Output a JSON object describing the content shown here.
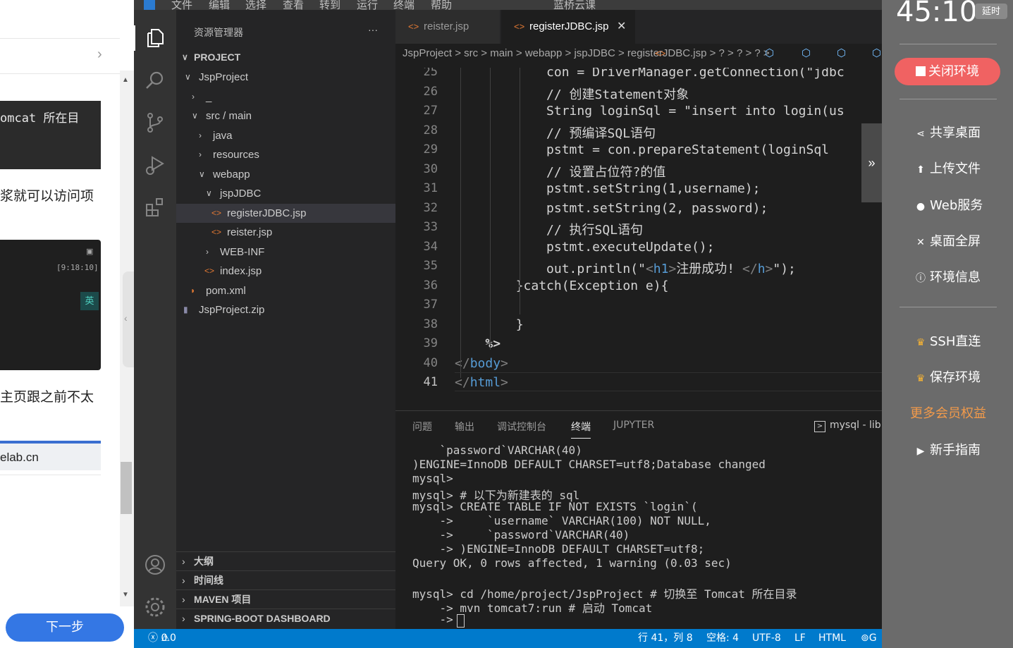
{
  "left_panel": {
    "t1": "omcat 所在目",
    "t2": "浆就可以访问项",
    "t3": "主页跟之前不太",
    "t4": "elab.cn",
    "term_time": "[9:18:10]",
    "term_lang": "英",
    "next_button": "下一步"
  },
  "menu": [
    "文件",
    "编辑",
    "选择",
    "查看",
    "转到",
    "运行",
    "终端",
    "帮助"
  ],
  "window_title": "蓝桥云课",
  "explorer": {
    "title": "资源管理器",
    "more": "···",
    "root": "PROJECT",
    "items": [
      {
        "label": "JspProject",
        "chev": "v",
        "indent": 22
      },
      {
        "label": "_",
        "chev": ">",
        "indent": 32
      },
      {
        "label": "src / main",
        "chev": "v",
        "indent": 32
      },
      {
        "label": "java",
        "chev": ">",
        "indent": 42
      },
      {
        "label": "resources",
        "chev": ">",
        "indent": 42
      },
      {
        "label": "webapp",
        "chev": "v",
        "indent": 42
      },
      {
        "label": "jspJDBC",
        "chev": "v",
        "indent": 52
      },
      {
        "label": "registerJDBC.jsp",
        "icon": "<>",
        "indent": 62
      },
      {
        "label": "reister.jsp",
        "icon": "<>",
        "indent": 62
      },
      {
        "label": "WEB-INF",
        "chev": ">",
        "indent": 52
      },
      {
        "label": "index.jsp",
        "icon": "<>",
        "indent": 52
      },
      {
        "label": "pom.xml",
        "icon": "rss",
        "indent": 32
      },
      {
        "label": "JspProject.zip",
        "icon": "zip",
        "indent": 22
      }
    ],
    "sections": [
      "大纲",
      "时间线",
      "MAVEN 项目",
      "SPRING-BOOT DASHBOARD"
    ]
  },
  "tabs": [
    {
      "label": "reister.jsp",
      "active": false
    },
    {
      "label": "registerJDBC.jsp",
      "active": true
    }
  ],
  "breadcrumb": "JspProject  >  src  >  main  >  webapp  >  jspJDBC  >   registerJDBC.jsp  >     ?  >     ?  >     ?  >",
  "code": {
    "lines": [
      {
        "n": "25",
        "text": "            con = DriverManager.getConnection(\"jdbc"
      },
      {
        "n": "26",
        "text": "            // 创建Statement对象"
      },
      {
        "n": "27",
        "text": "            String loginSql = \"insert into login(us"
      },
      {
        "n": "28",
        "text": "            // 预编译SQL语句"
      },
      {
        "n": "29",
        "text": "            pstmt = con.prepareStatement(loginSql"
      },
      {
        "n": "30",
        "text": "            // 设置占位符?的值"
      },
      {
        "n": "31",
        "text": "            pstmt.setString(1,username);"
      },
      {
        "n": "32",
        "text": "            pstmt.setString(2, password);"
      },
      {
        "n": "33",
        "text": "            // 执行SQL语句"
      },
      {
        "n": "34",
        "text": "            pstmt.executeUpdate();"
      },
      {
        "n": "35",
        "text": "            out.println(\"<h1>注册成功! </h>\");"
      },
      {
        "n": "36",
        "text": "        }catch(Exception e){"
      },
      {
        "n": "37",
        "text": ""
      },
      {
        "n": "38",
        "text": "        }"
      },
      {
        "n": "39",
        "text": "    %>"
      },
      {
        "n": "40",
        "text": "</body>"
      },
      {
        "n": "41",
        "text": "</html>"
      }
    ]
  },
  "panel": {
    "tabs": [
      "问题",
      "输出",
      "调试控制台",
      "终端",
      "JUPYTER"
    ],
    "active_tab": "终端",
    "terminal_name": "mysql - lib",
    "lines": [
      "    `password`VARCHAR(40)",
      ")ENGINE=InnoDB DEFAULT CHARSET=utf8;Database changed",
      "mysql>",
      "mysql> # 以下为新建表的 sql",
      "mysql> CREATE TABLE IF NOT EXISTS `login`(",
      "    ->     `username` VARCHAR(100) NOT NULL,",
      "    ->     `password`VARCHAR(40)",
      "    -> )ENGINE=InnoDB DEFAULT CHARSET=utf8;",
      "Query OK, 0 rows affected, 1 warning (0.03 sec)",
      "",
      "mysql> cd /home/project/JspProject # 切换至 Tomcat 所在目录",
      "    -> mvn tomcat7:run # 启动 Tomcat",
      "    -> "
    ]
  },
  "status": {
    "errors": "0",
    "warnings": "0",
    "position": "行 41，列 8",
    "spaces": "空格: 4",
    "encoding": "UTF-8",
    "eol": "LF",
    "language": "HTML",
    "extra": "G"
  },
  "right_panel": {
    "timer": "45:10",
    "extend": "延时",
    "close": "关闭环境",
    "items": [
      {
        "icon": "share-icon",
        "label": "共享桌面"
      },
      {
        "icon": "upload-icon",
        "label": "上传文件"
      },
      {
        "icon": "globe-icon",
        "label": "Web服务"
      },
      {
        "icon": "fullscreen-icon",
        "label": "桌面全屏"
      },
      {
        "icon": "info-icon",
        "label": "环境信息"
      }
    ],
    "ssh": "SSH直连",
    "save": "保存环境",
    "more": "更多会员权益",
    "guide": "新手指南"
  },
  "colors": {
    "accent_blue": "#007acc",
    "close_red": "#f06262",
    "more_orange": "#f29a4a",
    "next_blue": "#3477e4"
  }
}
